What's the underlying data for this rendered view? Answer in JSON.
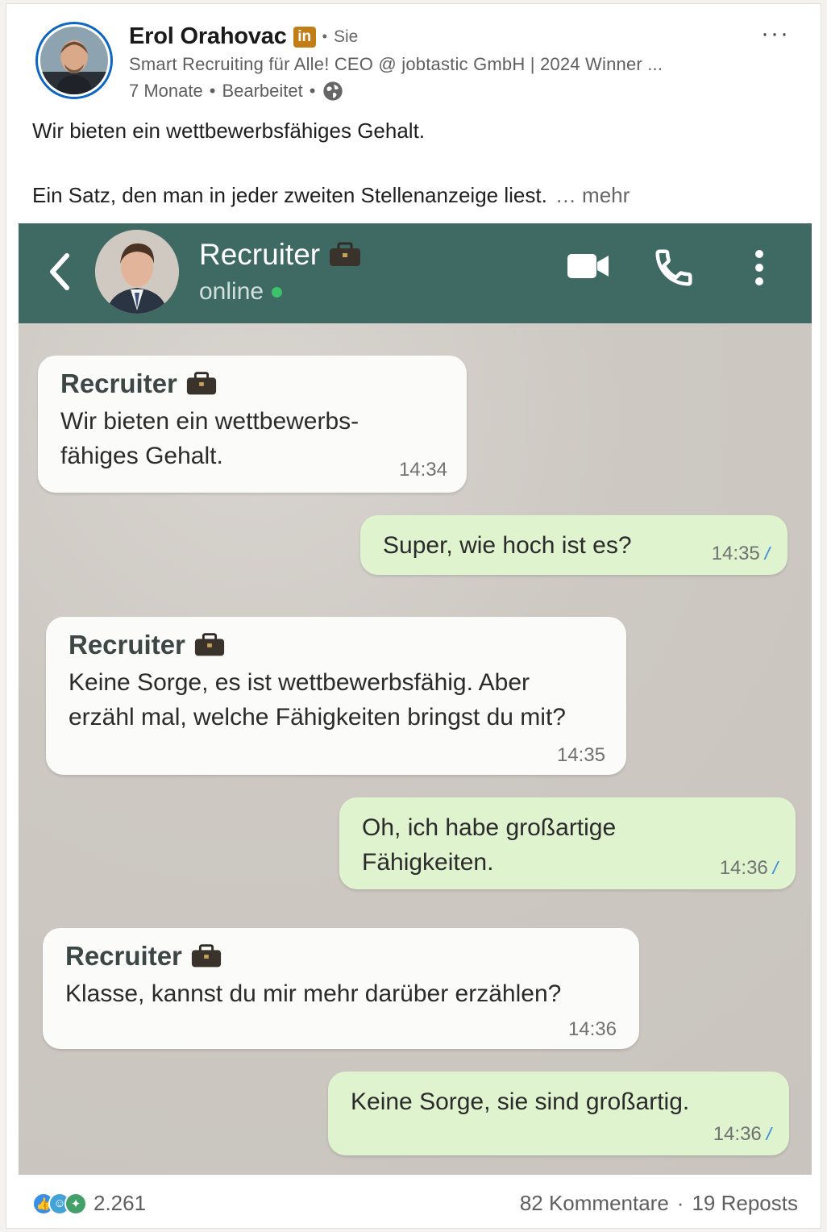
{
  "post": {
    "author_name": "Erol Orahovac",
    "badge": "in",
    "relation": "Sie",
    "headline": "Smart Recruiting für Alle! CEO @ jobtastic GmbH | 2024 Winner ...",
    "age": "7 Monate",
    "edited": "Bearbeitet",
    "visibility_icon": "globe-icon",
    "menu_label": "···",
    "text_line_1": "Wir bieten ein wettbewerbsfähiges Gehalt.",
    "text_line_2": "Ein Satz, den man in jeder zweiten Stellenanzeige liest.",
    "more_label": "… mehr"
  },
  "chat": {
    "contact_name": "Recruiter",
    "status": "online",
    "header_color": "#3f6a64",
    "messages": [
      {
        "direction": "in",
        "sender": "Recruiter",
        "lines": [
          "Wir bieten ein wettbewerbs-",
          "fähiges Gehalt."
        ],
        "time": "14:34"
      },
      {
        "direction": "out",
        "lines": [
          "Super, wie hoch ist es?"
        ],
        "time": "14:35"
      },
      {
        "direction": "in",
        "sender": "Recruiter",
        "lines": [
          "Keine Sorge, es ist wettbewerbsfähig. Aber",
          "erzähl mal, welche Fähigkeiten bringst du mit?"
        ],
        "time": "14:35"
      },
      {
        "direction": "out",
        "lines": [
          "Oh, ich habe großartige",
          "Fähigkeiten."
        ],
        "time": "14:36"
      },
      {
        "direction": "in",
        "sender": "Recruiter",
        "lines": [
          "Klasse, kannst du mir mehr darüber erzählen?"
        ],
        "time": "14:36"
      },
      {
        "direction": "out",
        "lines": [
          "Keine Sorge, sie sind großartig."
        ],
        "time": "14:36"
      }
    ]
  },
  "footer": {
    "reaction_count": "2.261",
    "comments": "82 Kommentare",
    "separator": "·",
    "reposts": "19 Reposts",
    "reaction_icons": [
      "like-icon",
      "funny-icon",
      "celebrate-icon"
    ]
  }
}
